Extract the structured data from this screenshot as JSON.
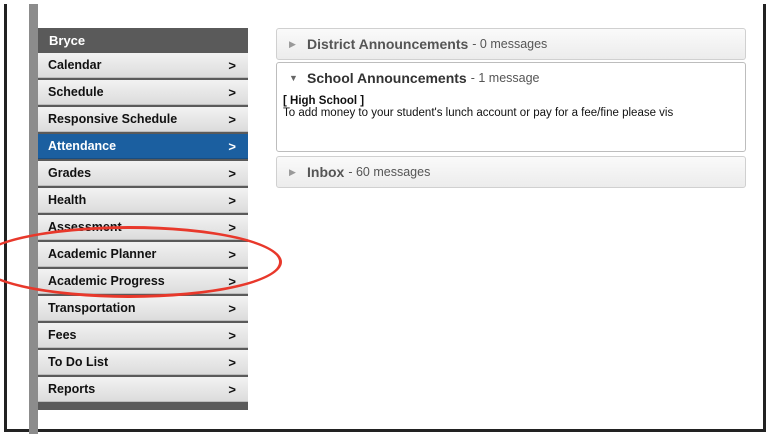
{
  "sidebar": {
    "user": "Bryce",
    "items": [
      {
        "label": "Calendar",
        "chevron": ">"
      },
      {
        "label": "Schedule",
        "chevron": ">"
      },
      {
        "label": "Responsive Schedule",
        "chevron": ">"
      },
      {
        "label": "Attendance",
        "chevron": ">",
        "active": true
      },
      {
        "label": "Grades",
        "chevron": ">"
      },
      {
        "label": "Health",
        "chevron": ">"
      },
      {
        "label": "Assessment",
        "chevron": ">"
      },
      {
        "label": "Academic Planner",
        "chevron": ">"
      },
      {
        "label": "Academic Progress",
        "chevron": ">"
      },
      {
        "label": "Transportation",
        "chevron": ">"
      },
      {
        "label": "Fees",
        "chevron": ">"
      },
      {
        "label": "To Do List",
        "chevron": ">"
      },
      {
        "label": "Reports",
        "chevron": ">"
      }
    ]
  },
  "panels": {
    "district": {
      "title": "District Announcements",
      "count": " - 0 messages",
      "state": "collapsed"
    },
    "school": {
      "title": "School Announcements",
      "count": " - 1 message",
      "state": "expanded",
      "school_tag": "[ High School ]",
      "message": "To add money to your student's lunch account or pay for a fee/fine please vis"
    },
    "inbox": {
      "title": "Inbox",
      "count": " - 60 messages",
      "state": "collapsed"
    }
  },
  "icons": {
    "collapsed": "triangle-right-icon",
    "expanded": "triangle-down-icon"
  },
  "colors": {
    "active_nav": "#1b5fa0",
    "annotation": "#e8382b",
    "sidebar_header": "#5a5a5a"
  }
}
